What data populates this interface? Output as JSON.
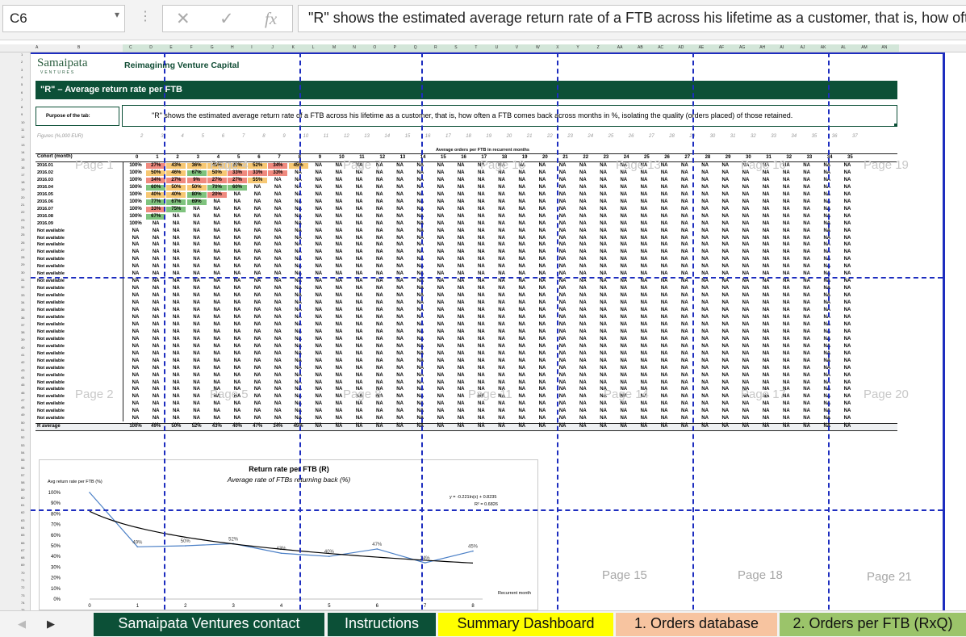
{
  "formula_bar": {
    "cell_ref": "C6",
    "formula_text": "\"R\" shows the estimated average return rate of a FTB across his lifetime as a customer, that is, how often a FTB comes back across months in %, isolating the quality (orders placed) of those retained."
  },
  "header": {
    "logo_text": "Samaipata",
    "logo_sub": "VENTURES",
    "tagline": "Reimagining Venture Capital"
  },
  "title_bar": "\"R\" – Average return rate per FTB",
  "purpose": {
    "label": "Purpose of the tab:",
    "text": "\"R\" shows the estimated average return rate of a FTB across his lifetime as a customer, that is, how often a FTB comes back across months in %, isolating the quality (orders placed) of those retained."
  },
  "figures_label": "Figures (%,000 EUR)",
  "table": {
    "group_header": "Average orders per FTB in recurrent months",
    "cohort_header": "Cohort (month)",
    "columns": [
      "0",
      "1",
      "2",
      "3",
      "4",
      "5",
      "6",
      "7",
      "8",
      "9",
      "10",
      "11",
      "12",
      "13",
      "14",
      "15",
      "16",
      "17",
      "18",
      "19",
      "20",
      "21",
      "22",
      "23",
      "24",
      "25",
      "26",
      "27",
      "28",
      "29",
      "30",
      "31",
      "32",
      "33",
      "34",
      "35"
    ],
    "rows": [
      {
        "cohort": "2016.01",
        "values": [
          "100%",
          "27%",
          "43%",
          "36%",
          "45%",
          "39%",
          "52%",
          "34%",
          "45%"
        ]
      },
      {
        "cohort": "2016.02",
        "values": [
          "100%",
          "50%",
          "46%",
          "67%",
          "50%",
          "33%",
          "33%",
          "33%"
        ]
      },
      {
        "cohort": "2016.03",
        "values": [
          "100%",
          "34%",
          "27%",
          "9%",
          "27%",
          "27%",
          "55%"
        ]
      },
      {
        "cohort": "2016.04",
        "values": [
          "100%",
          "60%",
          "50%",
          "50%",
          "70%",
          "60%"
        ]
      },
      {
        "cohort": "2016.05",
        "values": [
          "100%",
          "40%",
          "40%",
          "80%",
          "20%"
        ]
      },
      {
        "cohort": "2016.06",
        "values": [
          "100%",
          "77%",
          "67%",
          "69%"
        ]
      },
      {
        "cohort": "2016.07",
        "values": [
          "100%",
          "33%",
          "75%"
        ]
      },
      {
        "cohort": "2016.08",
        "values": [
          "100%",
          "67%"
        ]
      },
      {
        "cohort": "2016.09",
        "values": [
          "100%"
        ]
      }
    ],
    "not_available_label": "Not available",
    "not_available_count": 28,
    "na_value": "NA",
    "average_label": "R average",
    "average_values": [
      "100%",
      "49%",
      "50%",
      "52%",
      "43%",
      "40%",
      "47%",
      "34%",
      "45%"
    ]
  },
  "cell_colors": {
    "high": "#7fc37e",
    "mid": "#f7c874",
    "low": "#f08a7f"
  },
  "page_labels": [
    "Page 1",
    "Page 4",
    "Page 7",
    "Page 10",
    "Page 13",
    "Page 16",
    "Page 19",
    "Page 2",
    "Page 5",
    "Page 8",
    "Page 11",
    "Page 14",
    "Page 17",
    "Page 20",
    "Page 15",
    "Page 18",
    "Page 21"
  ],
  "chart_data": {
    "type": "line",
    "title": "Return rate per FTB (R)",
    "subtitle": "Average rate of FTBs returning back (%)",
    "ylabel": "Avg return rate per FTB (%)",
    "xlabel": "Recurrent month",
    "x": [
      0,
      1,
      2,
      3,
      4,
      5,
      6,
      7,
      8
    ],
    "ylim": [
      0,
      100
    ],
    "yticks": [
      "0%",
      "10%",
      "20%",
      "30%",
      "40%",
      "50%",
      "60%",
      "70%",
      "80%",
      "90%",
      "100%"
    ],
    "series": [
      {
        "values": [
          100,
          49,
          50,
          52,
          43,
          40,
          47,
          34,
          45
        ],
        "data_labels": [
          "",
          "49%",
          "50%",
          "52%",
          "43%",
          "40%",
          "47%",
          "34%",
          "45%"
        ],
        "color": "#4a7fc6"
      }
    ],
    "trendline": {
      "equation": "y = -0.221ln(x) + 0.8235",
      "r2": "R² = 0.6826",
      "color": "#000000"
    }
  },
  "sheet_tabs": [
    {
      "label": "Samaipata Ventures contact",
      "bg": "#0c5037",
      "fg": "#ffffff"
    },
    {
      "label": "Instructions",
      "bg": "#0c5037",
      "fg": "#ffffff"
    },
    {
      "label": "Summary Dashboard",
      "bg": "#ffff00",
      "fg": "#111111"
    },
    {
      "label": "1. Orders database",
      "bg": "#f7c4a0",
      "fg": "#111111"
    },
    {
      "label": "2. Orders per FTB (RxQ)",
      "bg": "#9bc46a",
      "fg": "#111111"
    }
  ]
}
